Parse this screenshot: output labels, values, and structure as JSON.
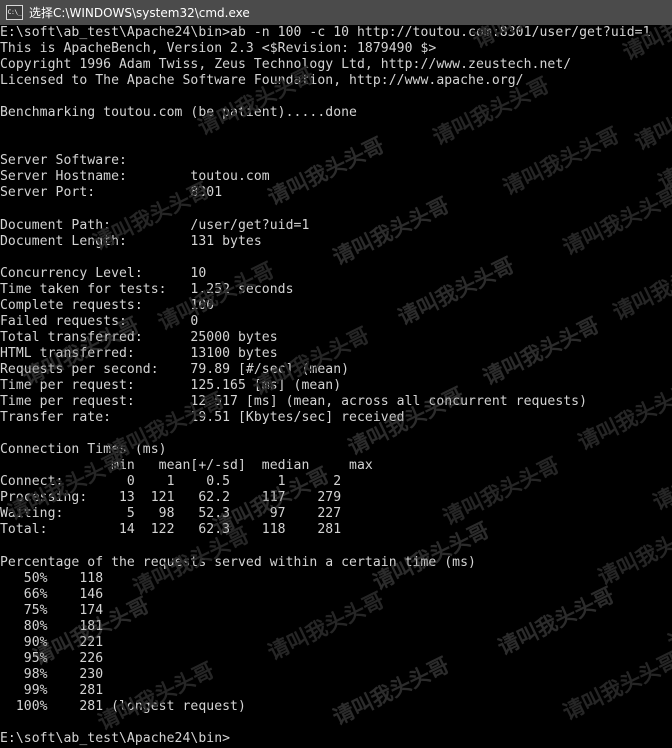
{
  "window": {
    "title": "选择C:\\WINDOWS\\system32\\cmd.exe",
    "icon_name": "cmd-console-icon",
    "icon_glyph": "C:\\_",
    "titlebar_color": "#4b4b4b",
    "background_color": "#000000",
    "text_color": "#d4d4d4"
  },
  "watermark": {
    "text": "请叫我头头哥",
    "color": "#2a2a2a",
    "rotation_deg": -26
  },
  "console": {
    "prompt": "E:\\soft\\ab_test\\Apache24\\bin>",
    "command": "ab -n 100 -c 10 http://toutou.com:8301/user/get?uid=1",
    "banner": [
      "This is ApacheBench, Version 2.3 <$Revision: 1879490 $>",
      "Copyright 1996 Adam Twiss, Zeus Technology Ltd, http://www.zeustech.net/",
      "Licensed to The Apache Software Foundation, http://www.apache.org/"
    ],
    "benchmarking_line": "Benchmarking toutou.com (be patient).....done",
    "server_info": [
      {
        "label": "Server Software:",
        "value": ""
      },
      {
        "label": "Server Hostname:",
        "value": "toutou.com"
      },
      {
        "label": "Server Port:",
        "value": "8301"
      }
    ],
    "document_info": [
      {
        "label": "Document Path:",
        "value": "/user/get?uid=1"
      },
      {
        "label": "Document Length:",
        "value": "131 bytes"
      }
    ],
    "summary": [
      {
        "label": "Concurrency Level:",
        "value": "10"
      },
      {
        "label": "Time taken for tests:",
        "value": "1.252 seconds"
      },
      {
        "label": "Complete requests:",
        "value": "100"
      },
      {
        "label": "Failed requests:",
        "value": "0"
      },
      {
        "label": "Total transferred:",
        "value": "25000 bytes"
      },
      {
        "label": "HTML transferred:",
        "value": "13100 bytes"
      },
      {
        "label": "Requests per second:",
        "value": "79.89 [#/sec] (mean)"
      },
      {
        "label": "Time per request:",
        "value": "125.165 [ms] (mean)"
      },
      {
        "label": "Time per request:",
        "value": "12.517 [ms] (mean, across all concurrent requests)"
      },
      {
        "label": "Transfer rate:",
        "value": "19.51 [Kbytes/sec] received"
      }
    ],
    "connection_times": {
      "title": "Connection Times (ms)",
      "columns": [
        "min",
        "mean[+/-sd]",
        "median",
        "max"
      ],
      "rows": [
        {
          "label": "Connect:",
          "min": "0",
          "mean": "1",
          "sd": "0.5",
          "median": "1",
          "max": "2"
        },
        {
          "label": "Processing:",
          "min": "13",
          "mean": "121",
          "sd": "62.2",
          "median": "117",
          "max": "279"
        },
        {
          "label": "Waiting:",
          "min": "5",
          "mean": "98",
          "sd": "52.3",
          "median": "97",
          "max": "227"
        },
        {
          "label": "Total:",
          "min": "14",
          "mean": "122",
          "sd": "62.3",
          "median": "118",
          "max": "281"
        }
      ]
    },
    "percentiles": {
      "title": "Percentage of the requests served within a certain time (ms)",
      "rows": [
        {
          "pct": "50%",
          "value": "118",
          "note": ""
        },
        {
          "pct": "66%",
          "value": "146",
          "note": ""
        },
        {
          "pct": "75%",
          "value": "174",
          "note": ""
        },
        {
          "pct": "80%",
          "value": "181",
          "note": ""
        },
        {
          "pct": "90%",
          "value": "221",
          "note": ""
        },
        {
          "pct": "95%",
          "value": "226",
          "note": ""
        },
        {
          "pct": "98%",
          "value": "230",
          "note": ""
        },
        {
          "pct": "99%",
          "value": "281",
          "note": ""
        },
        {
          "pct": "100%",
          "value": "281",
          "note": "(longest request)"
        }
      ]
    },
    "final_prompt": "E:\\soft\\ab_test\\Apache24\\bin>"
  }
}
